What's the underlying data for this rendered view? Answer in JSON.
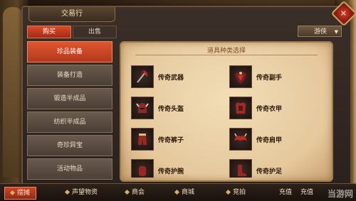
{
  "window": {
    "title": "交易行"
  },
  "tabs": [
    {
      "label": "购买"
    },
    {
      "label": "出售"
    }
  ],
  "class_select": {
    "value": "游侠"
  },
  "categories": [
    {
      "label": "珍品装备"
    },
    {
      "label": "装备打造"
    },
    {
      "label": "锻造半成品"
    },
    {
      "label": "纺织半成品"
    },
    {
      "label": "奇珍异宝"
    },
    {
      "label": "活动物品"
    }
  ],
  "panel": {
    "title": "道具种类选择"
  },
  "items": [
    {
      "label": "传奇武器",
      "icon": "axe-icon"
    },
    {
      "label": "传奇副手",
      "icon": "shield-icon"
    },
    {
      "label": "传奇头盔",
      "icon": "helmet-icon"
    },
    {
      "label": "传奇衣甲",
      "icon": "armor-icon"
    },
    {
      "label": "传奇裤子",
      "icon": "pants-icon"
    },
    {
      "label": "传奇肩甲",
      "icon": "shoulder-icon"
    },
    {
      "label": "传奇护腕",
      "icon": "bracer-icon"
    },
    {
      "label": "传奇护足",
      "icon": "boots-icon"
    }
  ],
  "bottom_tabs": [
    {
      "label": "摆摊"
    },
    {
      "label": "声望物资"
    },
    {
      "label": "商会"
    },
    {
      "label": "商城"
    },
    {
      "label": "竞拍"
    },
    {
      "label": "充值"
    },
    {
      "label": "充值"
    }
  ],
  "watermark": "当游网",
  "colors": {
    "accent": "#d84b2a",
    "parchment": "#ead3a8",
    "panel": "#332822"
  }
}
